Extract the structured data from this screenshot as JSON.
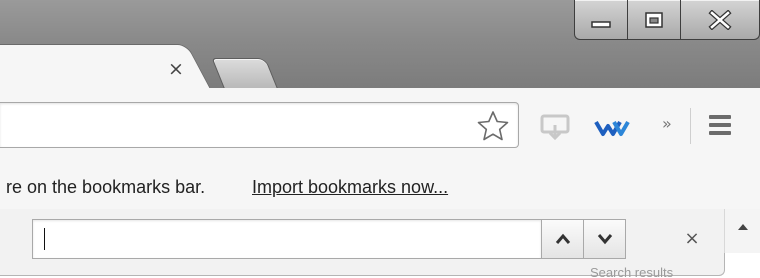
{
  "window": {
    "controls": [
      {
        "name": "minimize",
        "icon": "minimize-icon"
      },
      {
        "name": "maximize",
        "icon": "maximize-icon"
      },
      {
        "name": "close",
        "icon": "close-icon"
      }
    ]
  },
  "tabs": {
    "active_close_glyph": "×",
    "new_tab_icon": "new-tab-icon"
  },
  "toolbar": {
    "bookmark_star_icon": "star-icon",
    "extension_icons": [
      "cast-icon",
      "w-extension-icon"
    ],
    "overflow_glyph": "»",
    "menu_icon": "hamburger-menu-icon"
  },
  "bookmarks_bar": {
    "message": "re on the bookmarks bar.",
    "import_link": "Import bookmarks now..."
  },
  "find_bar": {
    "query": "",
    "close_glyph": "×",
    "partial_text": "Search results"
  },
  "colors": {
    "titlebar": "#8a8a8a",
    "toolbar": "#f6f6f6",
    "w_extension": "#1e5fbf"
  }
}
